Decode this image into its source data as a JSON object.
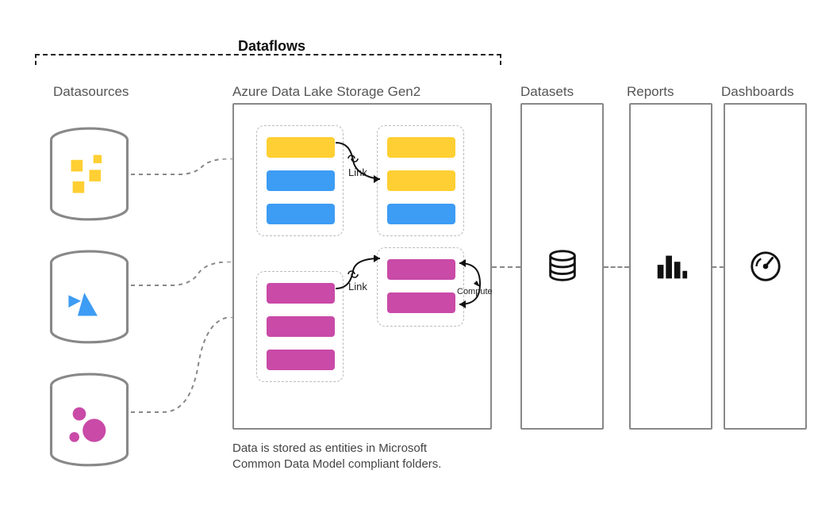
{
  "title": "Dataflows",
  "columns": {
    "datasources": "Datasources",
    "adls": "Azure Data Lake Storage Gen2",
    "datasets": "Datasets",
    "reports": "Reports",
    "dashboards": "Dashboards"
  },
  "annotations": {
    "link1": "Link",
    "link2": "Link",
    "compute": "Compute"
  },
  "caption_line1": "Data is stored as entities in Microsoft",
  "caption_line2": "Common Data Model compliant folders.",
  "colors": {
    "yellow": "#ffcf33",
    "blue": "#3d9cf4",
    "pink": "#c94aa7",
    "border": "#888888"
  },
  "entity_groups": [
    {
      "name": "group-top-left",
      "bars": [
        "yellow",
        "blue",
        "blue"
      ]
    },
    {
      "name": "group-top-right",
      "bars": [
        "yellow",
        "yellow",
        "blue"
      ]
    },
    {
      "name": "group-bottom-left",
      "bars": [
        "pink",
        "pink",
        "pink"
      ]
    },
    {
      "name": "group-bottom-right",
      "bars": [
        "pink",
        "pink"
      ]
    }
  ],
  "datasource_shapes": [
    "squares-yellow",
    "triangles-blue",
    "circles-pink"
  ]
}
